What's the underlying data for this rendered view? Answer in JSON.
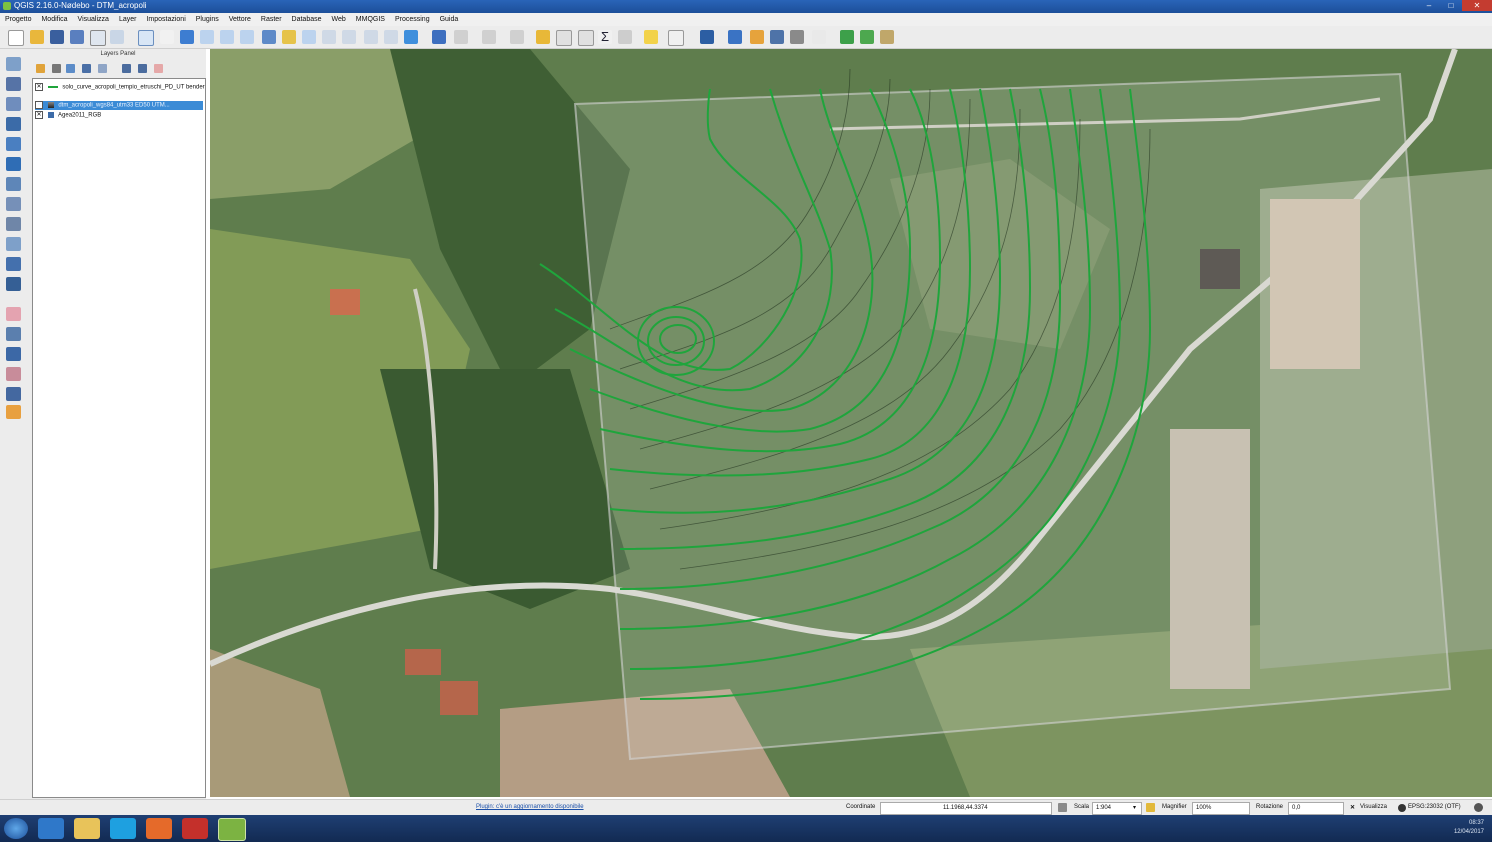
{
  "window": {
    "title": "QGIS 2.16.0-Nødebo - DTM_acropoli"
  },
  "menu": [
    "Progetto",
    "Modifica",
    "Visualizza",
    "Layer",
    "Impostazioni",
    "Plugins",
    "Vettore",
    "Raster",
    "Database",
    "Web",
    "MMQGIS",
    "Processing",
    "Guida"
  ],
  "layers_panel": {
    "title": "Layers Panel",
    "layers": [
      {
        "label": "solo_curve_acropoli_tempio_etruschi_PD_UT bender",
        "checked": true,
        "selected": false
      },
      {
        "label": "dtm_acropoli_wgs84_utm33 ED50 UTM...",
        "checked": true,
        "selected": true
      },
      {
        "label": "Agea2011_RGB",
        "checked": true,
        "selected": false
      }
    ]
  },
  "statusbar": {
    "message": "Plugin: c'è un aggiornamento disponibile",
    "coord_label": "Coordinate",
    "coord_value": "11.1968,44.3374",
    "scale_label": "Scala",
    "scale_value": "1:904",
    "magnifier_label": "Magnifier",
    "magnifier_value": "100%",
    "rotation_label": "Rotazione",
    "rotation_value": "0,0",
    "render_label": "Visualizza",
    "crs": "EPSG:23032 (OTF)"
  },
  "taskbar": {
    "time": "08:37",
    "date": "12/04/2017"
  },
  "colors": {
    "contour": "#1fa53c",
    "selection": "#3b8bd6",
    "titlebar": "#1d4f99"
  }
}
